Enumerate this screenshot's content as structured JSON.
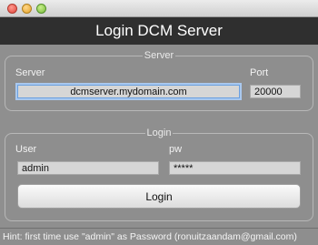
{
  "window": {
    "controls": [
      "close-icon",
      "minimize-icon",
      "maximize-icon"
    ]
  },
  "header": {
    "title": "Login DCM Server"
  },
  "server_section": {
    "legend": "Server",
    "server_label": "Server",
    "server_value": "dcmserver.mydomain.com",
    "port_label": "Port",
    "port_value": "20000"
  },
  "login_section": {
    "legend": "Login",
    "user_label": "User",
    "user_value": "admin",
    "password_label": "pw",
    "password_value": "*****",
    "login_button": "Login"
  },
  "status_bar": {
    "hint": "Hint: first time use \"admin\" as Password   (ronuitzaandam@gmail.com)"
  }
}
